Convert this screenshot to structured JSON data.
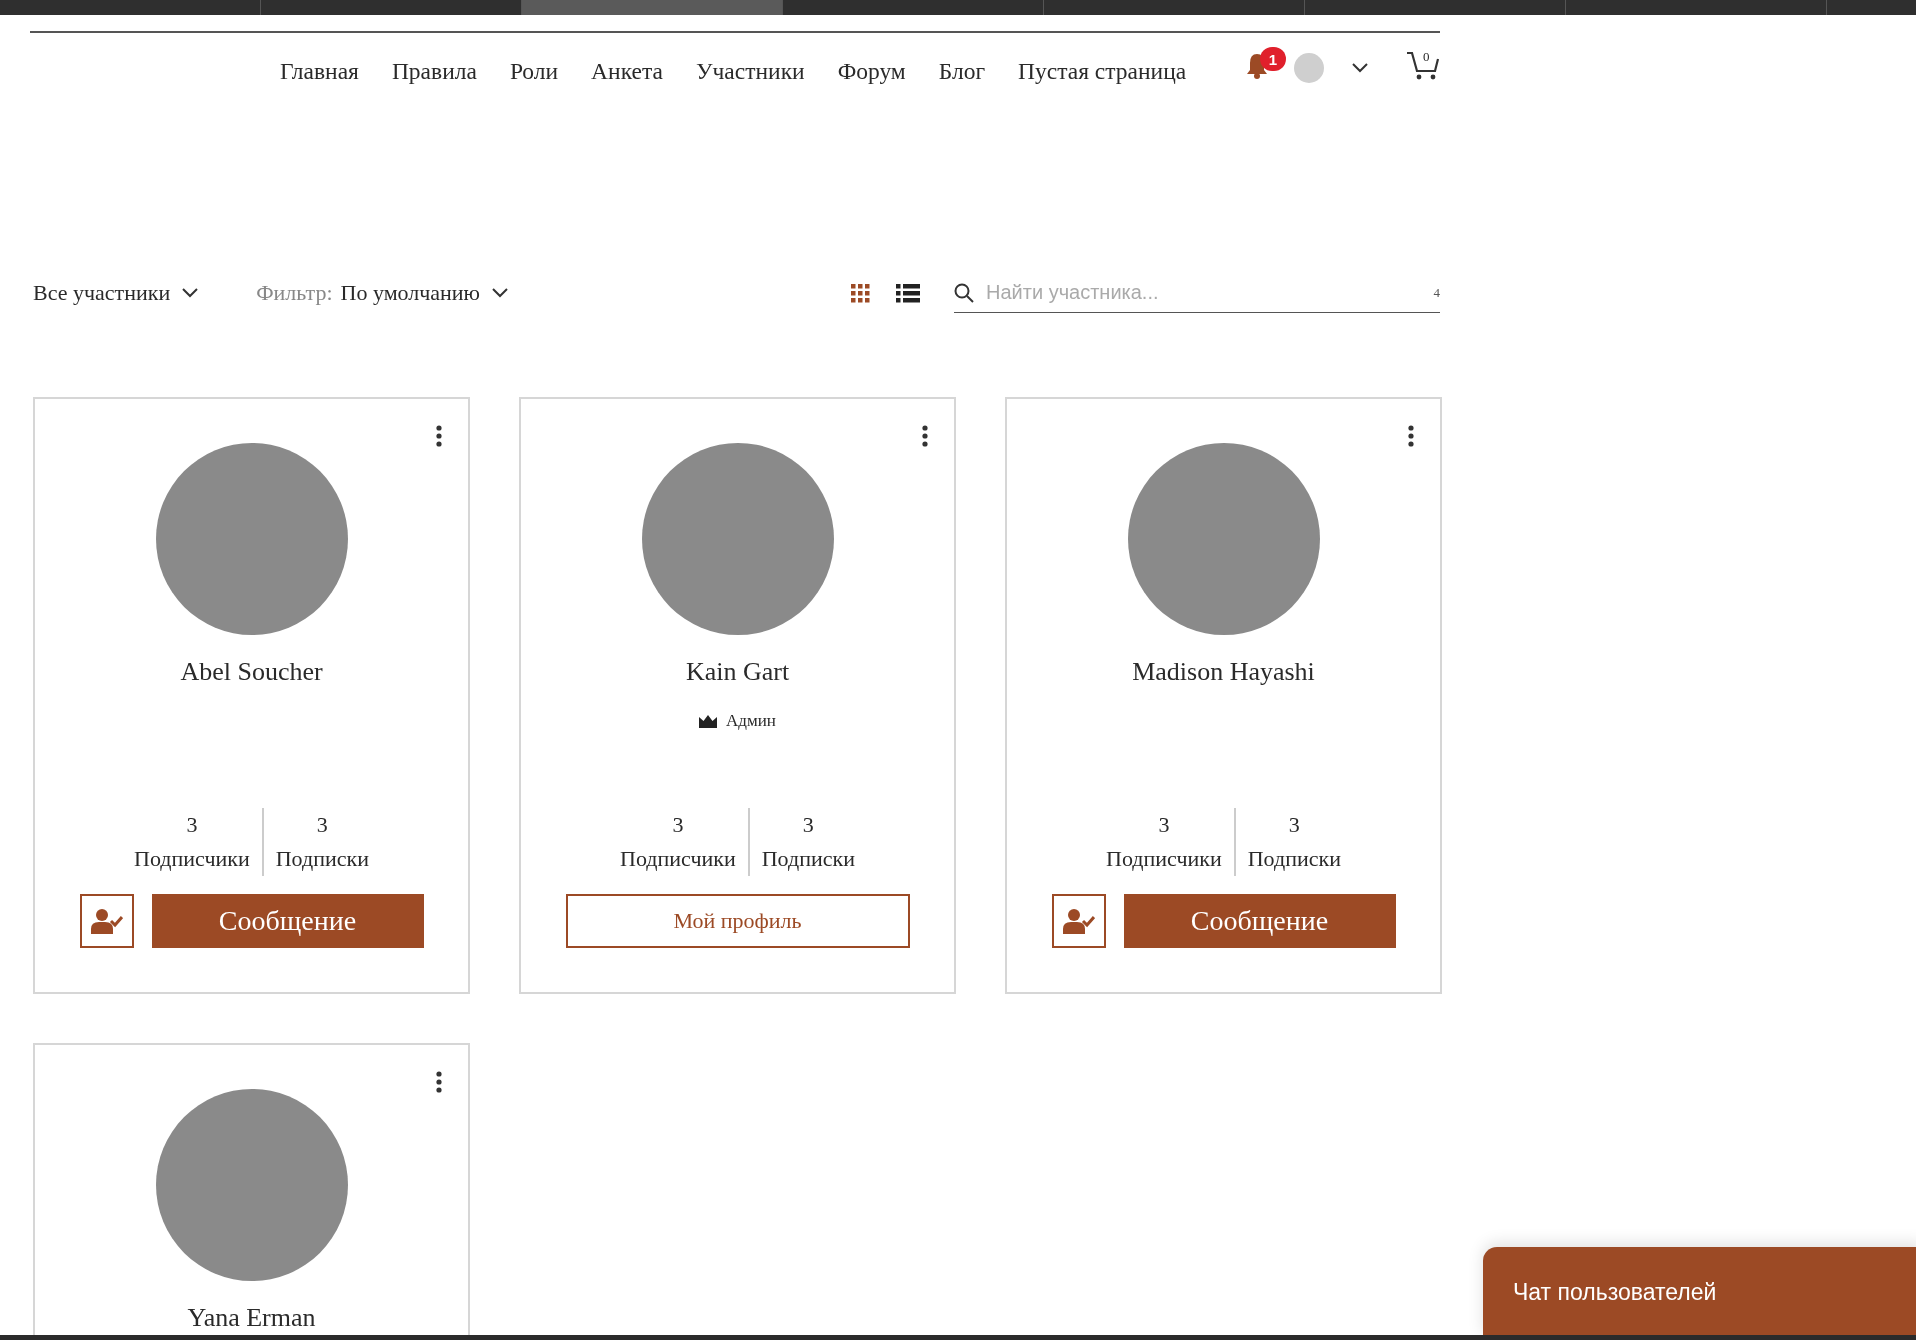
{
  "browser_tabs": [
    {
      "selected": false
    },
    {
      "selected": false
    },
    {
      "selected": true
    },
    {
      "selected": false
    },
    {
      "selected": false
    },
    {
      "selected": false
    },
    {
      "selected": false
    },
    {
      "selected": false
    }
  ],
  "nav": {
    "items": [
      "Главная",
      "Правила",
      "Роли",
      "Анкета",
      "Участники",
      "Форум",
      "Блог",
      "Пустая страница"
    ],
    "notifications": "1",
    "cart_count": "0"
  },
  "toolbar": {
    "scope": "Все участники",
    "filter_label": "Фильтр:",
    "filter_value": "По умолчанию",
    "views": [
      {
        "kind": "grid",
        "selected": true
      },
      {
        "kind": "list",
        "selected": false
      }
    ],
    "search": {
      "placeholder": "Найти участника...",
      "count": "4"
    }
  },
  "members": [
    {
      "name": "Abel Soucher",
      "followers": "3",
      "followers_label": "Подписчики",
      "following": "3",
      "following_label": "Подписки",
      "kind": "member",
      "button": "Сообщение"
    },
    {
      "name": "Kain Gart",
      "role": "Админ",
      "followers": "3",
      "followers_label": "Подписчики",
      "following": "3",
      "following_label": "Подписки",
      "kind": "self",
      "button": "Мой профиль"
    },
    {
      "name": "Madison Hayashi",
      "followers": "3",
      "followers_label": "Подписчики",
      "following": "3",
      "following_label": "Подписки",
      "kind": "member",
      "button": "Сообщение"
    },
    {
      "name": "Yana Erman"
    }
  ],
  "chat": {
    "title": "Чат пользователей"
  }
}
